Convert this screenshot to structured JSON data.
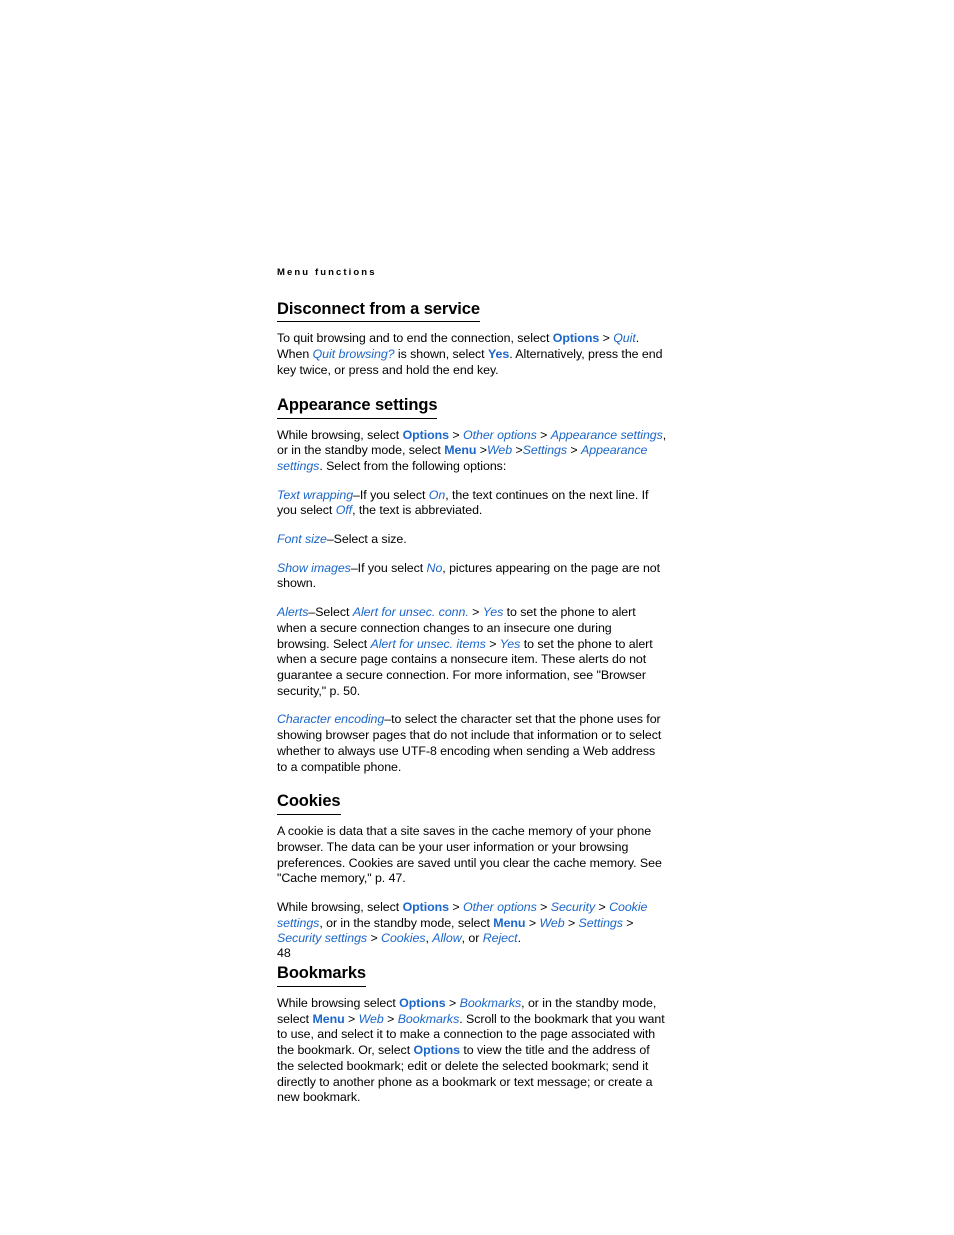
{
  "document": {
    "running_head": "Menu functions",
    "page_number": "48",
    "accent_color": "#1b66c9",
    "text_color": "#000000",
    "background_color": "#ffffff"
  },
  "sections": [
    {
      "id": "disconnect-from-a-service",
      "heading": "Disconnect from a service",
      "paragraphs": [
        {
          "id": "disconnect-p1",
          "runs": [
            {
              "text": "To quit browsing and to end the connection, select ",
              "style": "plain"
            },
            {
              "text": "Options",
              "style": "ui-bold"
            },
            {
              "text": " > ",
              "style": "sep"
            },
            {
              "text": "Quit",
              "style": "ui-italic"
            },
            {
              "text": ". When ",
              "style": "plain"
            },
            {
              "text": "Quit browsing?",
              "style": "ui-italic"
            },
            {
              "text": " is shown, select ",
              "style": "plain"
            },
            {
              "text": "Yes",
              "style": "ui-bold"
            },
            {
              "text": ". Alternatively, press the end key twice, or press and hold the end key.",
              "style": "plain"
            }
          ]
        }
      ]
    },
    {
      "id": "appearance-settings",
      "heading": "Appearance settings",
      "paragraphs": [
        {
          "id": "appearance-p1",
          "runs": [
            {
              "text": "While browsing, select ",
              "style": "plain"
            },
            {
              "text": "Options",
              "style": "ui-bold"
            },
            {
              "text": " > ",
              "style": "sep"
            },
            {
              "text": "Other options",
              "style": "ui-italic"
            },
            {
              "text": "  > ",
              "style": "sep"
            },
            {
              "text": "Appearance settings",
              "style": "ui-italic"
            },
            {
              "text": ", or in the standby mode, select ",
              "style": "plain"
            },
            {
              "text": "Menu",
              "style": "ui-bold"
            },
            {
              "text": " >",
              "style": "sep"
            },
            {
              "text": "Web",
              "style": "ui-italic"
            },
            {
              "text": " >",
              "style": "sep"
            },
            {
              "text": "Settings",
              "style": "ui-italic"
            },
            {
              "text": " > ",
              "style": "sep"
            },
            {
              "text": "Appearance settings",
              "style": "ui-italic"
            },
            {
              "text": ". Select from the following options:",
              "style": "plain"
            }
          ]
        },
        {
          "id": "appearance-p2-text-wrapping",
          "runs": [
            {
              "text": "Text wrapping",
              "style": "ui-italic"
            },
            {
              "text": "–If you select ",
              "style": "plain"
            },
            {
              "text": "On",
              "style": "ui-italic"
            },
            {
              "text": ", the text continues on the next line. If you select ",
              "style": "plain"
            },
            {
              "text": "Off",
              "style": "ui-italic"
            },
            {
              "text": ", the text is abbreviated.",
              "style": "plain"
            }
          ]
        },
        {
          "id": "appearance-p3-font-size",
          "runs": [
            {
              "text": "Font size",
              "style": "ui-italic"
            },
            {
              "text": "–Select a size.",
              "style": "plain"
            }
          ]
        },
        {
          "id": "appearance-p4-show-images",
          "runs": [
            {
              "text": "Show images",
              "style": "ui-italic"
            },
            {
              "text": "–If you select ",
              "style": "plain"
            },
            {
              "text": "No",
              "style": "ui-italic"
            },
            {
              "text": ", pictures appearing on the page are not shown.",
              "style": "plain"
            }
          ]
        },
        {
          "id": "appearance-p5-alerts",
          "runs": [
            {
              "text": "Alerts",
              "style": "ui-italic"
            },
            {
              "text": "–Select ",
              "style": "plain"
            },
            {
              "text": "Alert for unsec. conn.",
              "style": "ui-italic"
            },
            {
              "text": " > ",
              "style": "sep"
            },
            {
              "text": "Yes",
              "style": "ui-italic"
            },
            {
              "text": " to set the phone to alert when a secure connection changes to an insecure one during browsing. Select ",
              "style": "plain"
            },
            {
              "text": "Alert for unsec. items",
              "style": "ui-italic"
            },
            {
              "text": " > ",
              "style": "sep"
            },
            {
              "text": "Yes",
              "style": "ui-italic"
            },
            {
              "text": " to set the phone to alert when a secure page contains a nonsecure item. These alerts do not guarantee a secure connection. For more information, see \"Browser security,\" p. 50.",
              "style": "plain"
            }
          ]
        },
        {
          "id": "appearance-p6-character-encoding",
          "runs": [
            {
              "text": "Character encoding",
              "style": "ui-italic"
            },
            {
              "text": "–to select the character set that the phone uses for showing browser pages that do not include that information or to select whether to always use UTF-8 encoding when sending a Web address to a compatible phone.",
              "style": "plain"
            }
          ]
        }
      ]
    },
    {
      "id": "cookies",
      "heading": "Cookies",
      "paragraphs": [
        {
          "id": "cookies-p1",
          "runs": [
            {
              "text": "A cookie is data that a site saves in the cache memory of your phone browser. The data can be your user information or your browsing preferences. Cookies are saved until you clear the cache memory. See \"Cache memory,\" p. 47.",
              "style": "plain"
            }
          ]
        },
        {
          "id": "cookies-p2",
          "runs": [
            {
              "text": "While browsing, select ",
              "style": "plain"
            },
            {
              "text": "Options",
              "style": "ui-bold"
            },
            {
              "text": " > ",
              "style": "sep"
            },
            {
              "text": "Other options",
              "style": "ui-italic"
            },
            {
              "text": " > ",
              "style": "sep"
            },
            {
              "text": "Security",
              "style": "ui-italic"
            },
            {
              "text": "  > ",
              "style": "sep"
            },
            {
              "text": "Cookie settings",
              "style": "ui-italic"
            },
            {
              "text": ", or in the standby mode, select ",
              "style": "plain"
            },
            {
              "text": "Menu",
              "style": "ui-bold"
            },
            {
              "text": " > ",
              "style": "sep"
            },
            {
              "text": "Web",
              "style": "ui-italic"
            },
            {
              "text": " > ",
              "style": "sep"
            },
            {
              "text": "Settings",
              "style": "ui-italic"
            },
            {
              "text": " > ",
              "style": "sep"
            },
            {
              "text": "Security settings",
              "style": "ui-italic"
            },
            {
              "text": " > ",
              "style": "sep"
            },
            {
              "text": "Cookies",
              "style": "ui-italic"
            },
            {
              "text": ", ",
              "style": "plain"
            },
            {
              "text": "Allow",
              "style": "ui-italic"
            },
            {
              "text": ", or ",
              "style": "plain"
            },
            {
              "text": "Reject",
              "style": "ui-italic"
            },
            {
              "text": ".",
              "style": "plain"
            }
          ]
        }
      ]
    },
    {
      "id": "bookmarks",
      "heading": "Bookmarks",
      "paragraphs": [
        {
          "id": "bookmarks-p1",
          "runs": [
            {
              "text": "While browsing select ",
              "style": "plain"
            },
            {
              "text": "Options",
              "style": "ui-bold"
            },
            {
              "text": " > ",
              "style": "sep"
            },
            {
              "text": "Bookmarks",
              "style": "ui-italic"
            },
            {
              "text": ", or in the standby mode, select ",
              "style": "plain"
            },
            {
              "text": "Menu",
              "style": "ui-bold"
            },
            {
              "text": " > ",
              "style": "sep"
            },
            {
              "text": "Web",
              "style": "ui-italic"
            },
            {
              "text": " > ",
              "style": "sep"
            },
            {
              "text": "Bookmarks",
              "style": "ui-italic"
            },
            {
              "text": ". Scroll to the bookmark that you want to use, and select it to make a connection to the page associated with the bookmark. Or, select ",
              "style": "plain"
            },
            {
              "text": "Options",
              "style": "ui-bold"
            },
            {
              "text": " to view the title and the address of the selected bookmark; edit or delete the selected bookmark; send it directly to another phone as a bookmark or text message; or create a new bookmark.",
              "style": "plain"
            }
          ]
        }
      ]
    }
  ]
}
